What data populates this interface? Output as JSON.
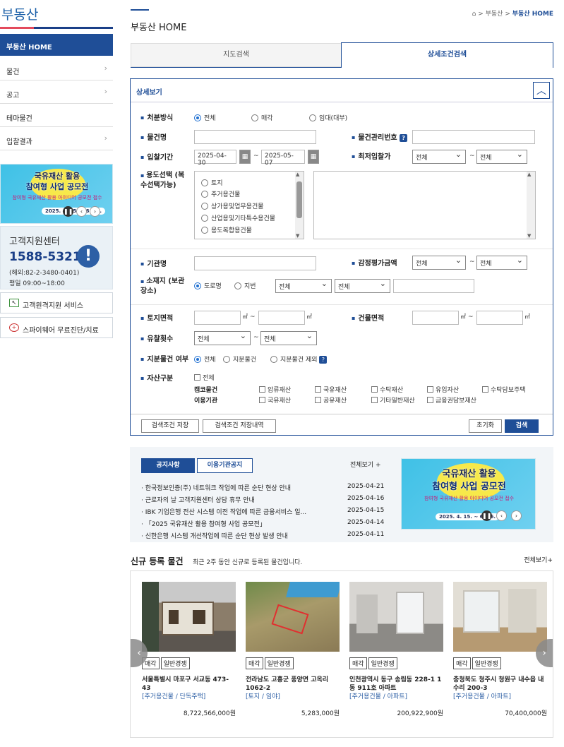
{
  "site": {
    "title": "부동산"
  },
  "leftnav": {
    "active": "부동산 HOME",
    "items": [
      "물건",
      "공고",
      "테마물건",
      "입찰결과"
    ]
  },
  "banner": {
    "line1": "국유재산 활용",
    "line2": "참여형 사업 공모전",
    "sub": "참여형 국유재산 활용 아이디어 공모전 접수",
    "date": "2025. 4. 15. ~ 6. 16."
  },
  "cs": {
    "title": "고객지원센터",
    "phone": "1588-5321",
    "abroad": "(해외:82-2-3480-0401)",
    "hours": "평일 09:00~18:00"
  },
  "side_links": [
    "고객원격지원 서비스",
    "스파이웨어 무료진단/치료"
  ],
  "header": {
    "page_title": "부동산 HOME",
    "breadcrumb": [
      "부동산",
      "부동산 HOME"
    ]
  },
  "tabs": {
    "map": "지도검색",
    "detail": "상세조건검색"
  },
  "search": {
    "header": "상세보기",
    "disposal_label": "처분방식",
    "disposal_options": [
      "전체",
      "매각",
      "임대(대부)"
    ],
    "item_name_label": "물건명",
    "mgmt_no_label": "물건관리번호",
    "bid_period_label": "입찰기간",
    "date_from": "2025-04-30",
    "date_to": "2025-05-07",
    "min_bid_label": "최저입찰가",
    "all": "전체",
    "usage_label": "용도선택 (복수선택가능)",
    "usage_options": [
      "토지",
      "주거용건물",
      "상가용및업무용건물",
      "산업용및기타특수용건물",
      "용도복합용건물"
    ],
    "agency_label": "기관명",
    "appraisal_label": "감정평가금액",
    "location_label": "소재지 (보관장소)",
    "location_options": [
      "도로명",
      "지번"
    ],
    "land_area_label": "토지면적",
    "building_area_label": "건물면적",
    "unit": "㎡",
    "tilde": "~",
    "fail_count_label": "유찰횟수",
    "share_label": "지분물건 여부",
    "share_options": [
      "전체",
      "지분물건",
      "지분물건 제외"
    ],
    "asset_label": "자산구분",
    "asset_all": "전체",
    "camco_label": "캠코물건",
    "org_label": "이용기관",
    "camco_options": [
      "압류재산",
      "국유재산",
      "수탁재산",
      "유입자산",
      "수탁담보주택"
    ],
    "org_options": [
      "국유재산",
      "공유재산",
      "기타일반재산",
      "금융권담보재산"
    ],
    "save_cond": "검색조건 저장",
    "save_history": "검색조건 저장내역",
    "reset": "초기화",
    "search": "검색"
  },
  "notice": {
    "tab_notice": "공지사항",
    "tab_org": "이용기관공지",
    "more": "전체보기 +",
    "items": [
      {
        "title": "한국정보인증(주) 네트워크 작업에 따른 순단 현상 안내",
        "date": "2025-04-21"
      },
      {
        "title": "근로자의 날 고객지원센터 상담 휴무 안내",
        "date": "2025-04-16"
      },
      {
        "title": "IBK 기업은행 전산 시스템 이전 작업에 따른 금융서비스 일...",
        "date": "2025-04-15"
      },
      {
        "title": "「2025 국유재산 활용 참여형 사업 공모전」",
        "date": "2025-04-14"
      },
      {
        "title": "신한은행 시스템 개선작업에 따른 순단 현상 발생 안내",
        "date": "2025-04-11"
      }
    ]
  },
  "new_listings": {
    "title": "신규 등록 물건",
    "subtitle": "최근 2주 동안 신규로 등록된 물건입니다.",
    "more": "전체보기+",
    "items": [
      {
        "tags": [
          "매각",
          "일반경쟁"
        ],
        "address": "서울특별시 마포구 서교동 473-43",
        "category": "[주거용건물 / 단독주택]",
        "price": "8,722,566,000원"
      },
      {
        "tags": [
          "매각",
          "일반경쟁"
        ],
        "address": "전라남도 고흥군 풍양면 고옥리 1062-2",
        "category": "[토지 / 임야]",
        "price": "5,283,000원"
      },
      {
        "tags": [
          "매각",
          "일반경쟁"
        ],
        "address": "인천광역시 동구 송림동 228-1 1동 911호 아파트",
        "category": "[주거용건물 / 아파트]",
        "price": "200,922,900원"
      },
      {
        "tags": [
          "매각",
          "일반경쟁"
        ],
        "address": "충청북도 청주시 청원구 내수읍 내수리 200-3",
        "category": "[주거용건물 / 아파트]",
        "price": "70,400,000원"
      }
    ]
  }
}
